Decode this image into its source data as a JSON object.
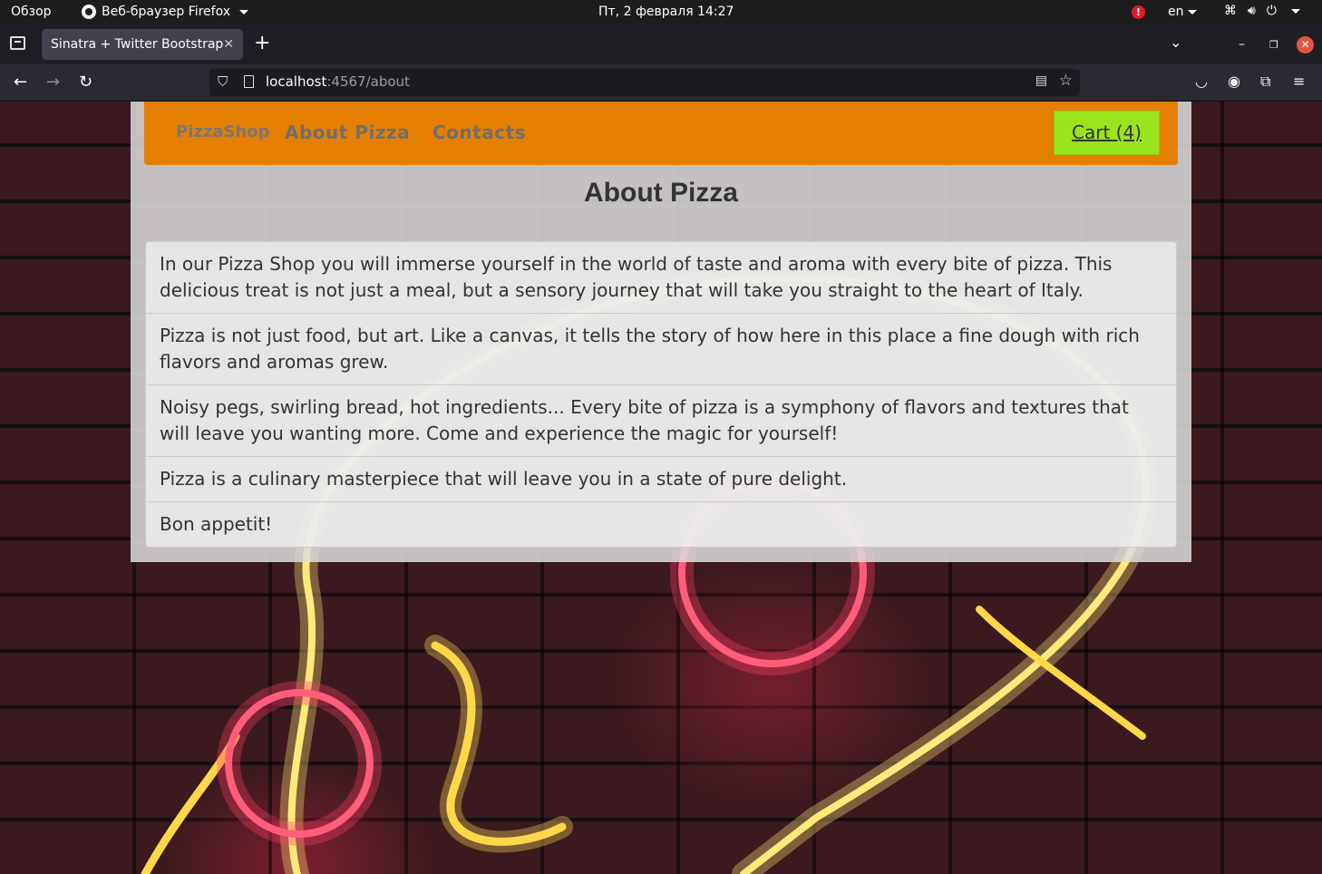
{
  "system": {
    "overview": "Обзор",
    "app_name": "Веб-браузер Firefox",
    "clock": "Пт, 2 февраля  14:27",
    "alert": "!",
    "lang": "en"
  },
  "browser": {
    "tab_title": "Sinatra + Twitter Bootstrap",
    "url_host": "localhost",
    "url_rest": ":4567/about"
  },
  "site": {
    "brand": "PizzaShop",
    "nav": [
      "About Pizza",
      "Contacts"
    ],
    "cart": "Cart (4)"
  },
  "main": {
    "title": "About Pizza",
    "paragraphs": [
      "In our Pizza Shop you will immerse yourself in the world of taste and aroma with every bite of pizza. This delicious treat is not just a meal, but a sensory journey that will take you straight to the heart of Italy.",
      "Pizza is not just food, but art. Like a canvas, it tells the story of how here in this place a fine dough with rich flavors and aromas grew.",
      "Noisy pegs, swirling bread, hot ingredients... Every bite of pizza is a symphony of flavors and textures that will leave you wanting more. Come and experience the magic for yourself!",
      "Pizza is a culinary masterpiece that will leave you in a state of pure delight.",
      "Bon appetit!"
    ]
  },
  "colors": {
    "navbar": "#e57f00",
    "cart_button": "#99e41d"
  }
}
